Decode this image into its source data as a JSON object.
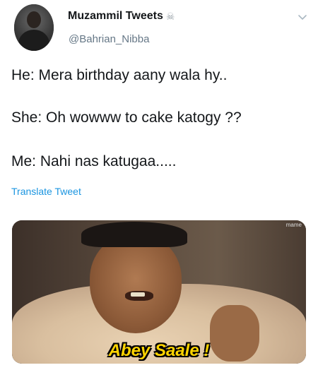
{
  "author": {
    "display_name": "Muzammil Tweets",
    "badge_icon": "skull-crossbones-icon",
    "handle": "@Bahrian_Nibba"
  },
  "tweet": {
    "lines": [
      "He: Mera birthday aany wala hy..",
      "She: Oh wowww to cake katogy ??",
      "Me: Nahi nas katugaa....."
    ]
  },
  "actions": {
    "translate_label": "Translate Tweet",
    "menu_icon": "chevron-down-icon"
  },
  "media": {
    "caption": "Abey Saale !",
    "watermark": "mame"
  },
  "colors": {
    "link": "#1b95e0",
    "secondary_text": "#657786",
    "caption": "#ffd400"
  }
}
